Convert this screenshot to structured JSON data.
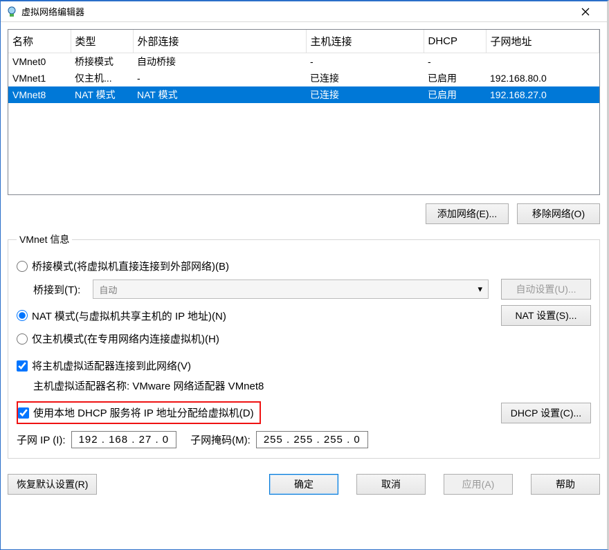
{
  "titlebar": {
    "title": "虚拟网络编辑器"
  },
  "table": {
    "headers": {
      "name": "名称",
      "type": "类型",
      "ext": "外部连接",
      "host": "主机连接",
      "dhcp": "DHCP",
      "subnet": "子网地址"
    },
    "rows": [
      {
        "name": "VMnet0",
        "type": "桥接模式",
        "ext": "自动桥接",
        "host": "-",
        "dhcp": "-",
        "subnet": ""
      },
      {
        "name": "VMnet1",
        "type": "仅主机...",
        "ext": "-",
        "host": "已连接",
        "dhcp": "已启用",
        "subnet": "192.168.80.0"
      },
      {
        "name": "VMnet8",
        "type": "NAT 模式",
        "ext": "NAT 模式",
        "host": "已连接",
        "dhcp": "已启用",
        "subnet": "192.168.27.0"
      }
    ]
  },
  "buttons": {
    "addNet": "添加网络(E)...",
    "removeNet": "移除网络(O)"
  },
  "vmnet": {
    "legend": "VMnet 信息",
    "bridged": "桥接模式(将虚拟机直接连接到外部网络)(B)",
    "bridgeTo": "桥接到(T):",
    "bridgeAuto": "自动",
    "autoSettings": "自动设置(U)...",
    "nat": "NAT 模式(与虚拟机共享主机的 IP 地址)(N)",
    "natSettings": "NAT 设置(S)...",
    "hostOnly": "仅主机模式(在专用网络内连接虚拟机)(H)",
    "connectHost": "将主机虚拟适配器连接到此网络(V)",
    "adapterName": "主机虚拟适配器名称: VMware 网络适配器 VMnet8",
    "useLocalDhcp": "使用本地 DHCP 服务将 IP 地址分配给虚拟机(D)",
    "dhcpSettings": "DHCP 设置(C)...",
    "subnetIp": "子网 IP (I):",
    "subnetIpVal": "192 . 168 . 27  .  0",
    "subnetMask": "子网掩码(M):",
    "subnetMaskVal": "255 . 255 . 255 .  0"
  },
  "footer": {
    "restore": "恢复默认设置(R)",
    "ok": "确定",
    "cancel": "取消",
    "apply": "应用(A)",
    "help": "帮助"
  }
}
